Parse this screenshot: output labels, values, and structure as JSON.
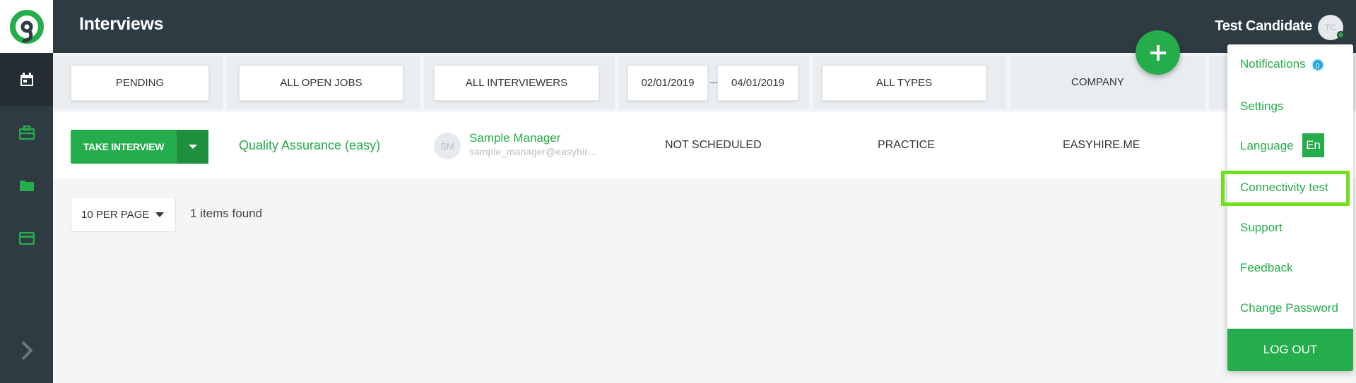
{
  "header": {
    "title": "Interviews",
    "user_name": "Test Candidate",
    "user_initials": "TC"
  },
  "sidebar": {
    "items": [
      {
        "icon": "calendar-icon",
        "active": true
      },
      {
        "icon": "briefcase-icon",
        "active": false
      },
      {
        "icon": "folder-icon",
        "active": false
      },
      {
        "icon": "card-icon",
        "active": false
      }
    ],
    "expand_icon": "chevron-right-icon"
  },
  "filters": {
    "status": "PENDING",
    "jobs": "ALL OPEN JOBS",
    "interviewers": "ALL INTERVIEWERS",
    "date_from": "02/01/2019",
    "date_to": "04/01/2019",
    "types": "ALL TYPES",
    "company_header": "COMPANY"
  },
  "row": {
    "action_label": "TAKE INTERVIEW",
    "job_title": "Quality Assurance (easy)",
    "manager_initials": "SM",
    "manager_name": "Sample Manager",
    "manager_email": "sample_manager@easyhire.me",
    "schedule_status": "NOT SCHEDULED",
    "type": "PRACTICE",
    "company": "EASYHIRE.ME"
  },
  "pagination": {
    "per_page": "10 PER PAGE",
    "items_found": "1 items found"
  },
  "user_menu": {
    "notifications_label": "Notifications",
    "notifications_count": "0",
    "settings_label": "Settings",
    "language_label": "Language",
    "language_value": "En",
    "connectivity_label": "Connectivity test",
    "support_label": "Support",
    "feedback_label": "Feedback",
    "change_password_label": "Change Password",
    "logout_label": "LOG OUT"
  },
  "colors": {
    "accent": "#24ad4a",
    "sidebar": "#2f3b43",
    "highlight": "#6fe11a",
    "badge": "#20a7e0"
  }
}
